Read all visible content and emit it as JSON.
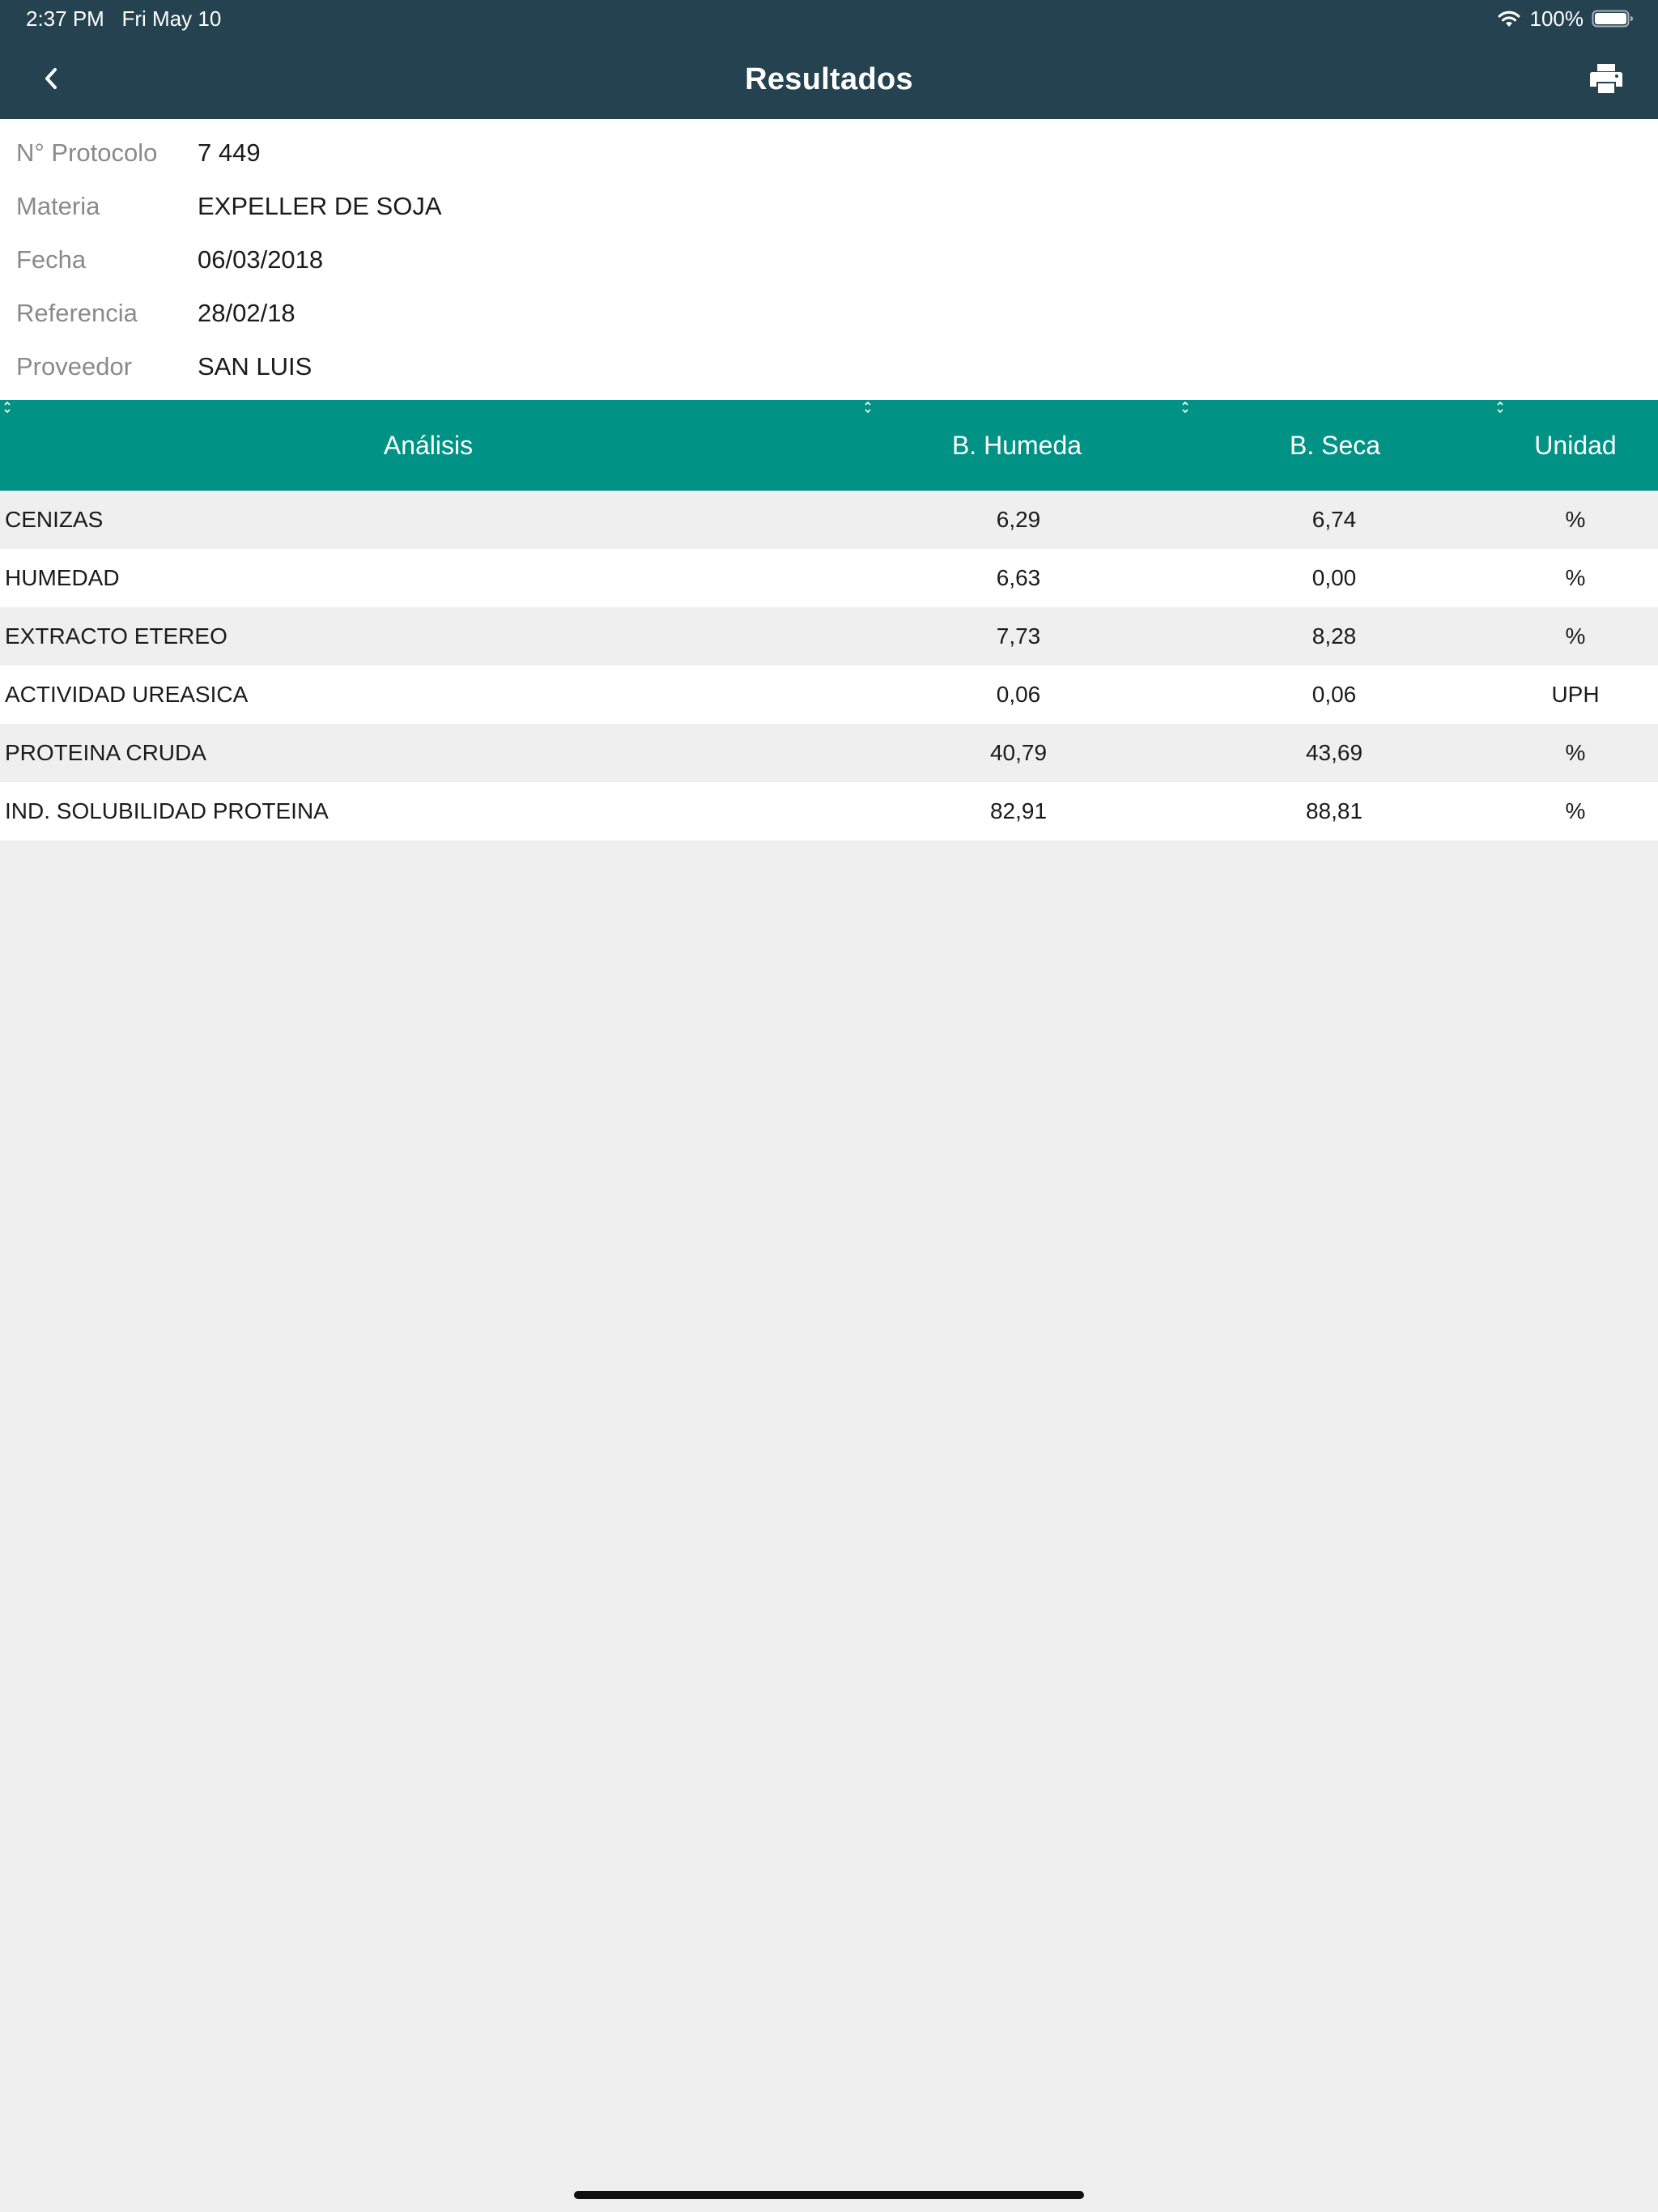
{
  "status_bar": {
    "time": "2:37 PM",
    "date": "Fri May 10",
    "battery_percent": "100%",
    "wifi_icon": "wifi-icon",
    "battery_icon": "battery-icon"
  },
  "nav": {
    "title": "Resultados",
    "back_icon": "chevron-left-icon",
    "print_icon": "printer-icon"
  },
  "info": [
    {
      "label": "N° Protocolo",
      "value": "7 449"
    },
    {
      "label": "Materia",
      "value": "EXPELLER DE SOJA"
    },
    {
      "label": "Fecha",
      "value": "06/03/2018"
    },
    {
      "label": "Referencia",
      "value": "28/02/18"
    },
    {
      "label": "Proveedor",
      "value": "SAN LUIS"
    }
  ],
  "table": {
    "columns": [
      "Análisis",
      "B. Humeda",
      "B. Seca",
      "Unidad"
    ],
    "rows": [
      [
        "CENIZAS",
        "6,29",
        "6,74",
        "%"
      ],
      [
        "HUMEDAD",
        "6,63",
        "0,00",
        "%"
      ],
      [
        "EXTRACTO ETEREO",
        "7,73",
        "8,28",
        "%"
      ],
      [
        "ACTIVIDAD UREASICA",
        "0,06",
        "0,06",
        "UPH"
      ],
      [
        "PROTEINA CRUDA",
        "40,79",
        "43,69",
        "%"
      ],
      [
        "IND. SOLUBILIDAD PROTEINA",
        "82,91",
        "88,81",
        "%"
      ]
    ]
  },
  "colors": {
    "nav_background": "#254250",
    "table_header": "#009285",
    "row_alt": "#efefef"
  }
}
